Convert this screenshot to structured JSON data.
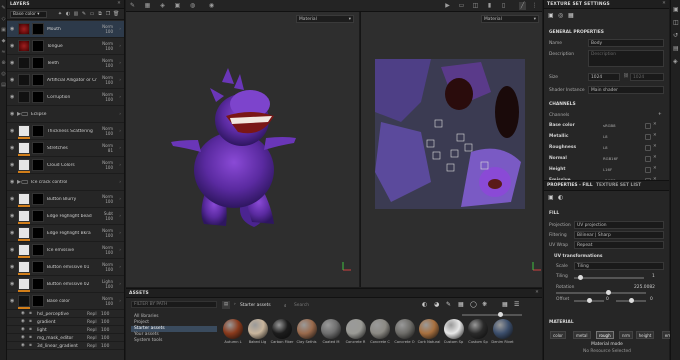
{
  "layers_panel": {
    "title": "LAYERS",
    "channel_select": "Base color",
    "layers": [
      {
        "name": "Mouth",
        "blend": "Norm",
        "opacity": "100",
        "thumb": "red",
        "selected": true
      },
      {
        "name": "Tongue",
        "blend": "Norm",
        "opacity": "100",
        "thumb": "red"
      },
      {
        "name": "Teeth",
        "blend": "Norm",
        "opacity": "100",
        "thumb": "dark"
      },
      {
        "name": "Artificial Alligator or Crocodil",
        "blend": "Norm",
        "opacity": "100",
        "thumb": "dark"
      },
      {
        "name": "Corruption",
        "blend": "Norm",
        "opacity": "100",
        "thumb": "dark"
      },
      {
        "name": "Eclipse",
        "blend": "",
        "opacity": "",
        "thumb": "folder"
      },
      {
        "name": "Thickness Scattering",
        "blend": "Norm",
        "opacity": "100",
        "thumb": "white"
      },
      {
        "name": "Stretches",
        "blend": "Norm",
        "opacity": "81",
        "thumb": "white"
      },
      {
        "name": "Cloud Colors",
        "blend": "Norm",
        "opacity": "100",
        "thumb": "white"
      },
      {
        "name": "Ice crack control",
        "blend": "",
        "opacity": "",
        "thumb": "folder"
      },
      {
        "name": "Button Blurry",
        "blend": "Norm",
        "opacity": "100",
        "thumb": "white"
      },
      {
        "name": "Edge Highlight bead",
        "blend": "Subt",
        "opacity": "100",
        "thumb": "white"
      },
      {
        "name": "Edge Highlight Bkra",
        "blend": "Norm",
        "opacity": "100",
        "thumb": "white"
      },
      {
        "name": "Ice emissive",
        "blend": "Norm",
        "opacity": "100",
        "thumb": "white"
      },
      {
        "name": "Button emissive 01",
        "blend": "Norm",
        "opacity": "100",
        "thumb": "white"
      },
      {
        "name": "Button emissive 02",
        "blend": "Lighn",
        "opacity": "100",
        "thumb": "white"
      },
      {
        "name": "Base color",
        "blend": "Norm",
        "opacity": "100",
        "thumb": "dark"
      }
    ],
    "sublayers": [
      {
        "name": "hsl_perceptive",
        "blend": "Repl",
        "opacity": "100"
      },
      {
        "name": "gradient",
        "blend": "Repl",
        "opacity": "100"
      },
      {
        "name": "light",
        "blend": "Repl",
        "opacity": "100"
      },
      {
        "name": "mg_mask_editor",
        "blend": "Repl",
        "opacity": "100"
      },
      {
        "name": "3d_linear_gradient",
        "blend": "Repl",
        "opacity": "100"
      }
    ]
  },
  "viewport": {
    "view3d_select": "Material",
    "view2d_select": "Material"
  },
  "assets": {
    "title": "ASSETS",
    "filter_placeholder": "FILTER BY PATH",
    "categories": [
      "All libraries",
      "Project",
      "Starter assets",
      "Your assets",
      "System tools"
    ],
    "active_category": "Starter assets",
    "breadcrumb": "Starter assets",
    "search_placeholder": "Search",
    "materials": [
      {
        "name": "Autumn L",
        "color": "#8a3a1c"
      },
      {
        "name": "Baked Lig",
        "color": "#c9b59c"
      },
      {
        "name": "Carbon Fiber",
        "color": "#1c1c1c"
      },
      {
        "name": "Clay Sethis",
        "color": "#9a6a4c"
      },
      {
        "name": "Coated M",
        "color": "#6f6f6f"
      },
      {
        "name": "Concrete R",
        "color": "#9a9a95"
      },
      {
        "name": "Concrete C",
        "color": "#8c8a84"
      },
      {
        "name": "Concrete O",
        "color": "#6d6c68"
      },
      {
        "name": "Cork Natural",
        "color": "#a8703f"
      },
      {
        "name": "Custom Sp",
        "color": "#e8e8e8"
      },
      {
        "name": "Custom Sp",
        "color": "#2a2a2a"
      },
      {
        "name": "Denim Rivet",
        "color": "#3c4f6d"
      }
    ]
  },
  "texture_set_settings": {
    "title": "TEXTURE SET SETTINGS",
    "general_title": "GENERAL PROPERTIES",
    "name_label": "Name",
    "name_value": "Body",
    "description_label": "Description",
    "description_placeholder": "Description",
    "size_label": "Size",
    "size_value": "1024",
    "size_value2": "1024",
    "shader_label": "Shader Instance",
    "shader_value": "Main shader",
    "channels_title": "CHANNELS",
    "channels_label": "Channels",
    "channels": [
      {
        "name": "Base color",
        "format": "sRGB8"
      },
      {
        "name": "Metallic",
        "format": "L8"
      },
      {
        "name": "Roughness",
        "format": "L8"
      },
      {
        "name": "Normal",
        "format": "RGB16F"
      },
      {
        "name": "Height",
        "format": "L16F"
      },
      {
        "name": "Emissive",
        "format": "sRGB8"
      }
    ]
  },
  "properties": {
    "tab_fill": "PROPERTIES - FILL",
    "tab_tsl": "TEXTURE SET LIST",
    "fill_title": "FILL",
    "projection_label": "Projection",
    "projection_value": "UV projection",
    "filtering_label": "Filtering",
    "filtering_value": "Bilinear | Sharp",
    "uvwrap_label": "UV Wrap",
    "uvwrap_value": "Repeat",
    "uvt_title": "UV transformations",
    "scale_label": "Scale",
    "scale_value": "Tiling",
    "tiling_label": "Tiling",
    "tiling_value": "1",
    "rotation_label": "Rotation",
    "rotation_value": "225.0082",
    "offset_label": "Offset",
    "offset_x": "0",
    "offset_y": "0",
    "material_title": "MATERIAL",
    "chips": [
      "color",
      "metal",
      "rough",
      "nrm",
      "height",
      "emiss"
    ],
    "material_mode": "Material mode",
    "no_resource": "No Resource Selected"
  }
}
